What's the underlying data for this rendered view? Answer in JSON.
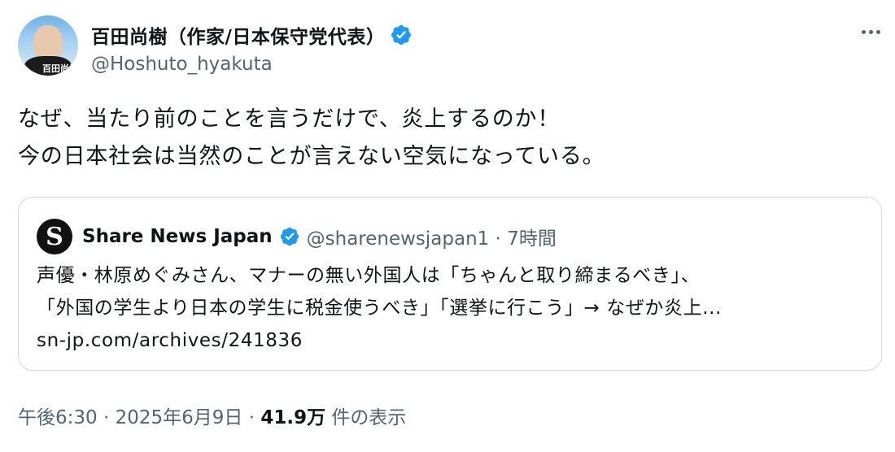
{
  "author": {
    "display_name": "百田尚樹（作家/日本保守党代表）",
    "handle": "@Hoshuto_hyakuta",
    "avatar_overlay_text": "百田尚樹",
    "verified_icon": "verified-badge-icon",
    "verified_color": "#1d9bf0"
  },
  "more_icon": "more-options-icon",
  "tweet": {
    "lines": [
      "なぜ、当たり前のことを言うだけで、炎上するのか！",
      "今の日本社会は当然のことが言えない空気になっている。"
    ]
  },
  "quote": {
    "avatar_letter": "S",
    "name": "Share News Japan",
    "handle_time": "@sharenewsjapan1 · 7時間",
    "lines": [
      "声優・林原めぐみさん、マナーの無い外国人は「ちゃんと取り締まるべき」、",
      "「外国の学生より日本の学生に税金使うべき」「選挙に行こう」→ なぜか炎上...",
      "sn-jp.com/archives/241836"
    ]
  },
  "meta": {
    "time": "午後6:30",
    "sep1": " · ",
    "date": "2025年6月9日",
    "sep2": " · ",
    "views": "41.9万",
    "views_label": " 件の表示"
  }
}
